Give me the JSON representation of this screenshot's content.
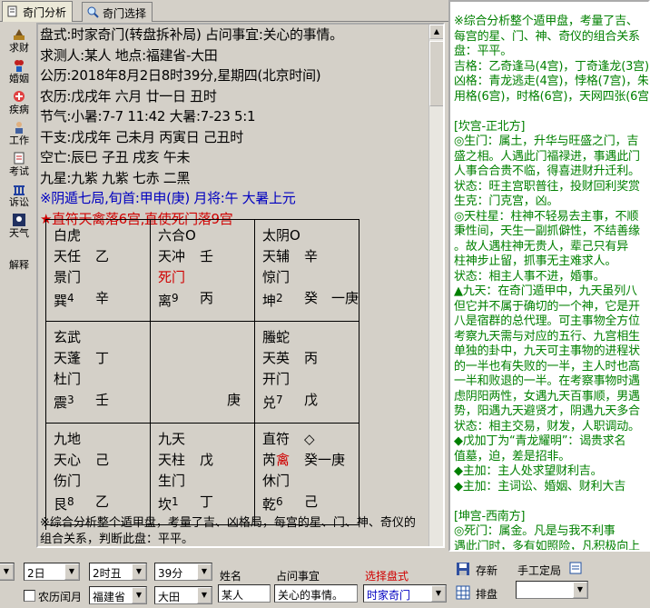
{
  "tabs": [
    {
      "label": "奇门分析"
    },
    {
      "label": "奇门选择"
    }
  ],
  "sidebar": [
    {
      "label": "求财"
    },
    {
      "label": "婚姻"
    },
    {
      "label": "疾病"
    },
    {
      "label": "工作"
    },
    {
      "label": "考试"
    },
    {
      "label": "诉讼"
    },
    {
      "label": "天气"
    },
    {
      "label": "解释"
    }
  ],
  "info": [
    "盘式:时家奇门(转盘拆补局)   占问事宜:关心的事情。",
    "求测人:某人  地点:福建省-大田",
    "公历:2018年8月2日8时39分,星期四(北京时间)",
    "农历:戊戌年  六月  廿一日  丑时",
    "节气:小暑:7-7 11:42   大暑:7-23 5:1",
    "干支:戊戌年  己未月  丙寅日  己丑时",
    "空亡:辰巳     子丑     戌亥     午未",
    "九星:九紫     九紫     七赤     二黑"
  ],
  "ju_line": "※阴遁七局,旬首:甲申(庚)   月将:午   大暑上元",
  "zhifu_line": "★直符天禽落6宫,直使死门落9宫",
  "palaces": [
    {
      "god": "白虎",
      "god_sym": "",
      "star": "天任",
      "star_stem": "乙",
      "door": "景门",
      "gua": "巽",
      "num": "4",
      "stem": "辛",
      "extra": ""
    },
    {
      "god": "六合",
      "god_sym": "O",
      "star": "天冲",
      "star_stem": "壬",
      "door": "死门",
      "gua": "离",
      "num": "9",
      "stem": "丙",
      "extra": ""
    },
    {
      "god": "太阴",
      "god_sym": "O",
      "star": "天辅",
      "star_stem": "辛",
      "door": "惊门",
      "gua": "坤",
      "num": "2",
      "stem": "癸",
      "extra": "一庚"
    },
    {
      "god": "玄武",
      "god_sym": "",
      "star": "天蓬",
      "star_stem": "丁",
      "door": "杜门",
      "gua": "震",
      "num": "3",
      "stem": "壬",
      "extra": ""
    },
    {
      "god": "",
      "god_sym": "",
      "star": "",
      "star_stem": "",
      "door": "",
      "gua": "",
      "num": "",
      "stem": "庚",
      "extra": ""
    },
    {
      "god": "螣蛇",
      "god_sym": "",
      "star": "天英",
      "star_stem": "丙",
      "door": "开门",
      "gua": "兑",
      "num": "7",
      "stem": "戊",
      "extra": ""
    },
    {
      "god": "九地",
      "god_sym": "",
      "star": "天心",
      "star_stem": "己",
      "door": "伤门",
      "gua": "艮",
      "num": "8",
      "stem": "乙",
      "extra": ""
    },
    {
      "god": "九天",
      "god_sym": "",
      "star": "天柱",
      "star_stem": "戊",
      "door": "生门",
      "gua": "坎",
      "num": "1",
      "stem": "丁",
      "extra": ""
    },
    {
      "god": "直符",
      "god_sym": "◇",
      "star": "芮",
      "star_red": "禽",
      "star_stem": "癸一庚",
      "door": "休门",
      "gua": "乾",
      "num": "6",
      "stem": "己",
      "extra": ""
    }
  ],
  "footer": [
    "※综合分析整个遁甲盘，考量了吉、凶格局，每宫的星、门、神、奇仪的",
    "组合关系，判断此盘：平平。"
  ],
  "right_lines": [
    "※综合分析整个遁甲盘，考量了吉、",
    "每宫的星、门、神、奇仪的组合关系",
    "盘：平平。",
    "吉格：乙奇逢马(4宫)，丁奇逢龙(3宫)",
    "凶格：青龙逃走(4宫)，悖格(7宫)，朱",
    "用格(6宫)，时格(6宫)，天网四张(6宫)",
    "",
    "[坎宫-正北方]",
    "◎生门：属土，升华与旺盛之门，吉",
    "盛之相。人遇此门福禄进，事遇此门",
    "人事合合贵不临，得喜进财升迁利。",
    "状态：旺主宫职普往，投财回利奖赏",
    "生克：门克宫，凶。",
    "◎天柱星：柱神不轻易去主事，不顺",
    "秉性间，天生一副抓僻性，不结善缘",
    "。故人遇柱神无贵人，辈己只有异",
    "柱神步止留，抓事无主难求人。",
    "状态：相主人事不进，婚事。",
    "▲九天：在奇门遁甲中，九天虽列八",
    "但它并不属于确切的一个神，它是开",
    "八是宿群的总代理。可主事物全方位",
    "考察九天需与对应的五行、九宫相生",
    "单独的卦中，九天可主事物的进程状",
    "的一半也有失败的一半，主人时也高",
    "一半和败退的一半。在考察事物时遇",
    "虑阴阳两性，女遇九天百事顺，男遇",
    "势，阳遇九天避贤才，阴遇九天多合",
    "状态：相主交易，财发，人职调动。",
    "◆戊加丁为“青龙耀明”：谒贵求名",
    "值墓，迫，差是招非。",
    "◆主加：主人处求望财利吉。",
    "◆主加：主词讼、婚姻、财利大吉",
    "",
    "[坤宫-西南方]",
    "◎死门：属金。凡是与我不利事",
    "遇此门时，多有如照险，凡积极向上",
    "遇此门，多停留不前，好事多蹉磨",
    "此门多怀往，事遇此门小人多，好事",
    "避，生性多险难成，不失官财和升人",
    "状态：相主财失，信息不至恐惧。",
    "生克：宫生门，吉。"
  ],
  "bottom": {
    "day": "2日",
    "hour": "2时丑",
    "minute": "39分",
    "name_label": "姓名",
    "name_value": "某人",
    "question_label": "占问事宜",
    "question_value": "关心的事情。",
    "pan_label": "选择盘式",
    "pan_value": "时家奇门",
    "province": "福建省",
    "city": "大田",
    "lunar_label": "农历闰月",
    "save_label": "存新",
    "arrange_label": "排盘",
    "manual_label": "手工定局"
  }
}
